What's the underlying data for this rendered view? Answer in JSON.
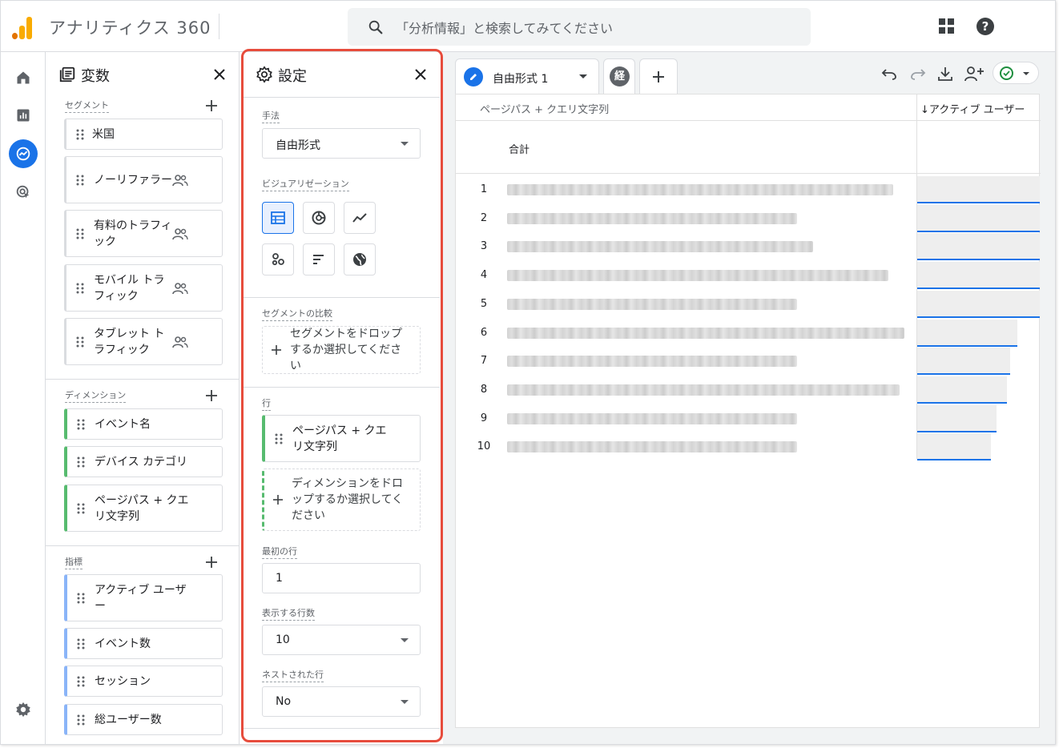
{
  "app": {
    "title": "アナリティクス 360"
  },
  "search": {
    "placeholder": "「分析情報」と検索してみてください"
  },
  "variables": {
    "title": "変数",
    "segments_label": "セグメント",
    "segments": [
      "米国",
      "ノーリファラー",
      "有料のトラフィック",
      "モバイル トラフィック",
      "タブレット トラフィック"
    ],
    "dimensions_label": "ディメンション",
    "dimensions": [
      "イベント名",
      "デバイス カテゴリ",
      "ページパス + クエリ文字列"
    ],
    "metrics_label": "指標",
    "metrics": [
      "アクティブ ユーザー",
      "イベント数",
      "セッション",
      "総ユーザー数"
    ]
  },
  "settings": {
    "title": "設定",
    "technique_label": "手法",
    "technique_value": "自由形式",
    "visualization_label": "ビジュアリゼーション",
    "selected_visualization": "table",
    "segment_compare_label": "セグメントの比較",
    "segment_drop_text": "セグメントをドロップするか選択してください",
    "rows_label": "行",
    "row_dimension": "ページパス + クエリ文字列",
    "row_drop_text": "ディメンションをドロップするか選択してください",
    "first_row_label": "最初の行",
    "first_row_value": "1",
    "show_rows_label": "表示する行数",
    "show_rows_value": "10",
    "nested_rows_label": "ネストされた行",
    "nested_rows_value": "No"
  },
  "tabs": [
    {
      "label": "自由形式 1"
    },
    {
      "label": "経"
    }
  ],
  "report": {
    "dimension_header": "ページパス + クエリ文字列",
    "metric_header": "↓アクティブ ユーザー",
    "total_label": "合計",
    "rows": [
      {
        "n": "1",
        "bar": 1.0
      },
      {
        "n": "2",
        "bar": 1.0
      },
      {
        "n": "3",
        "bar": 1.0
      },
      {
        "n": "4",
        "bar": 1.0
      },
      {
        "n": "5",
        "bar": 1.0
      },
      {
        "n": "6",
        "bar": 0.82
      },
      {
        "n": "7",
        "bar": 0.76
      },
      {
        "n": "8",
        "bar": 0.73
      },
      {
        "n": "9",
        "bar": 0.65
      },
      {
        "n": "10",
        "bar": 0.6
      }
    ]
  },
  "colors": {
    "accent": "#1a73e8",
    "highlight_outline": "#e74c3c",
    "dimension": "#57bb6f",
    "metric": "#8ab4f8"
  },
  "icons": [
    "apps-icon",
    "help-icon",
    "home-icon",
    "reports-icon",
    "explore-icon",
    "advertising-icon",
    "settings-gear-icon",
    "undo-icon",
    "redo-icon",
    "download-icon",
    "share-icon",
    "check-icon"
  ]
}
